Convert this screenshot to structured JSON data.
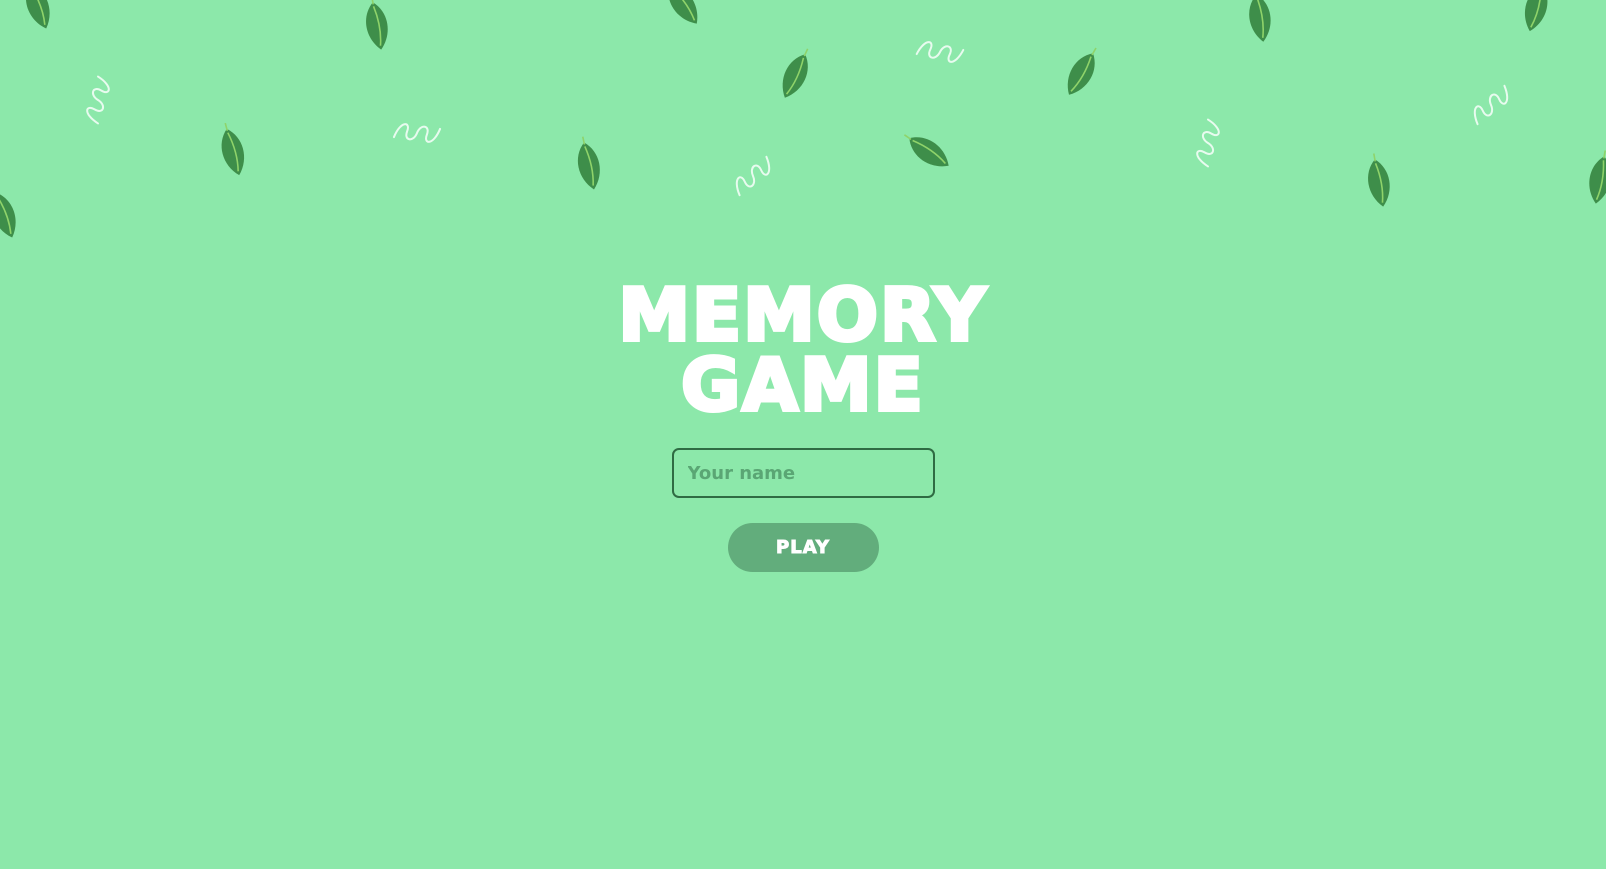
{
  "game": {
    "title_line1": "MEMORY",
    "title_line2": "GAME"
  },
  "form": {
    "name_placeholder": "Your name",
    "name_value": "",
    "play_label": "PLAY"
  },
  "decor": {
    "leaf_color": "#3e8e4a",
    "leaf_vein_color": "#8fd36a",
    "swirl_color": "#e8fbef",
    "icons": [
      "leaf-icon",
      "swirl-icon"
    ]
  },
  "colors": {
    "background": "#8ce8aa",
    "button": "#62ad7c",
    "input_border": "#2f6b43",
    "title": "#ffffff"
  }
}
